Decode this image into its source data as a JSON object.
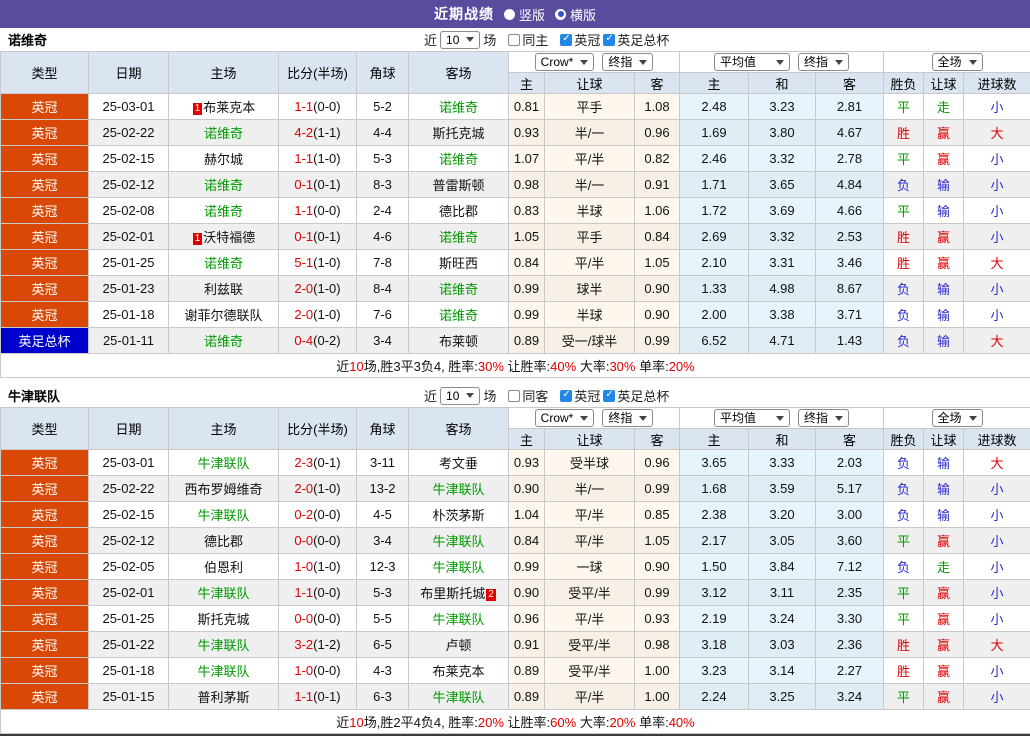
{
  "header": {
    "title": "近期战绩",
    "vertical": "竖版",
    "horizontal": "横版"
  },
  "controls": {
    "recent": "近",
    "count": "10",
    "matches": "场",
    "crow": "Crow*",
    "final": "终指",
    "avg": "平均值",
    "full": "全场"
  },
  "filters": {
    "league": "英冠",
    "cup": "英足总杯"
  },
  "columns": {
    "main": [
      "类型",
      "日期",
      "主场",
      "比分(半场)",
      "角球",
      "客场"
    ],
    "sub": [
      "主",
      "让球",
      "客",
      "主",
      "和",
      "客",
      "胜负",
      "让球",
      "进球数"
    ]
  },
  "tables": [
    {
      "team": "诺维奇",
      "same_label": "同主",
      "recent_count": "10",
      "rows": [
        {
          "type": "英冠",
          "type_style": "league",
          "date": "25-03-01",
          "home": {
            "name": "布莱克本",
            "green": false,
            "badge": "1",
            "badge_pos": "before"
          },
          "score": "1-1",
          "half": "(0-0)",
          "corner": "5-2",
          "away": {
            "name": "诺维奇",
            "green": true
          },
          "crow_home": "0.81",
          "handicap": "平手",
          "crow_away": "1.08",
          "avg_home": "2.48",
          "avg_draw": "3.23",
          "avg_away": "2.81",
          "result": "平",
          "handicap_result": "走",
          "goals": "小"
        },
        {
          "type": "英冠",
          "type_style": "league",
          "date": "25-02-22",
          "home": {
            "name": "诺维奇",
            "green": true
          },
          "score": "4-2",
          "half": "(1-1)",
          "corner": "4-4",
          "away": {
            "name": "斯托克城",
            "green": false
          },
          "crow_home": "0.93",
          "handicap": "半/一",
          "crow_away": "0.96",
          "avg_home": "1.69",
          "avg_draw": "3.80",
          "avg_away": "4.67",
          "result": "胜",
          "handicap_result": "赢",
          "goals": "大"
        },
        {
          "type": "英冠",
          "type_style": "league",
          "date": "25-02-15",
          "home": {
            "name": "赫尔城",
            "green": false
          },
          "score": "1-1",
          "half": "(1-0)",
          "corner": "5-3",
          "away": {
            "name": "诺维奇",
            "green": true
          },
          "crow_home": "1.07",
          "handicap": "平/半",
          "crow_away": "0.82",
          "avg_home": "2.46",
          "avg_draw": "3.32",
          "avg_away": "2.78",
          "result": "平",
          "handicap_result": "赢",
          "goals": "小"
        },
        {
          "type": "英冠",
          "type_style": "league",
          "date": "25-02-12",
          "home": {
            "name": "诺维奇",
            "green": true
          },
          "score": "0-1",
          "half": "(0-1)",
          "corner": "8-3",
          "away": {
            "name": "普雷斯顿",
            "green": false
          },
          "crow_home": "0.98",
          "handicap": "半/一",
          "crow_away": "0.91",
          "avg_home": "1.71",
          "avg_draw": "3.65",
          "avg_away": "4.84",
          "result": "负",
          "handicap_result": "输",
          "goals": "小"
        },
        {
          "type": "英冠",
          "type_style": "league",
          "date": "25-02-08",
          "home": {
            "name": "诺维奇",
            "green": true
          },
          "score": "1-1",
          "half": "(0-0)",
          "corner": "2-4",
          "away": {
            "name": "德比郡",
            "green": false
          },
          "crow_home": "0.83",
          "handicap": "半球",
          "crow_away": "1.06",
          "avg_home": "1.72",
          "avg_draw": "3.69",
          "avg_away": "4.66",
          "result": "平",
          "handicap_result": "输",
          "goals": "小"
        },
        {
          "type": "英冠",
          "type_style": "league",
          "date": "25-02-01",
          "home": {
            "name": "沃特福德",
            "green": false,
            "badge": "1",
            "badge_pos": "before"
          },
          "score": "0-1",
          "half": "(0-1)",
          "corner": "4-6",
          "away": {
            "name": "诺维奇",
            "green": true
          },
          "crow_home": "1.05",
          "handicap": "平手",
          "crow_away": "0.84",
          "avg_home": "2.69",
          "avg_draw": "3.32",
          "avg_away": "2.53",
          "result": "胜",
          "handicap_result": "赢",
          "goals": "小"
        },
        {
          "type": "英冠",
          "type_style": "league",
          "date": "25-01-25",
          "home": {
            "name": "诺维奇",
            "green": true
          },
          "score": "5-1",
          "half": "(1-0)",
          "corner": "7-8",
          "away": {
            "name": "斯旺西",
            "green": false
          },
          "crow_home": "0.84",
          "handicap": "平/半",
          "crow_away": "1.05",
          "avg_home": "2.10",
          "avg_draw": "3.31",
          "avg_away": "3.46",
          "result": "胜",
          "handicap_result": "赢",
          "goals": "大"
        },
        {
          "type": "英冠",
          "type_style": "league",
          "date": "25-01-23",
          "home": {
            "name": "利兹联",
            "green": false
          },
          "score": "2-0",
          "half": "(1-0)",
          "corner": "8-4",
          "away": {
            "name": "诺维奇",
            "green": true
          },
          "crow_home": "0.99",
          "handicap": "球半",
          "crow_away": "0.90",
          "avg_home": "1.33",
          "avg_draw": "4.98",
          "avg_away": "8.67",
          "result": "负",
          "handicap_result": "输",
          "goals": "小"
        },
        {
          "type": "英冠",
          "type_style": "league",
          "date": "25-01-18",
          "home": {
            "name": "谢菲尔德联队",
            "green": false
          },
          "score": "2-0",
          "half": "(1-0)",
          "corner": "7-6",
          "away": {
            "name": "诺维奇",
            "green": true
          },
          "crow_home": "0.99",
          "handicap": "半球",
          "crow_away": "0.90",
          "avg_home": "2.00",
          "avg_draw": "3.38",
          "avg_away": "3.71",
          "result": "负",
          "handicap_result": "输",
          "goals": "小"
        },
        {
          "type": "英足总杯",
          "type_style": "cup",
          "date": "25-01-11",
          "home": {
            "name": "诺维奇",
            "green": true
          },
          "score": "0-4",
          "half": "(0-2)",
          "corner": "3-4",
          "away": {
            "name": "布莱顿",
            "green": false
          },
          "crow_home": "0.89",
          "handicap": "受一/球半",
          "crow_away": "0.99",
          "avg_home": "6.52",
          "avg_draw": "4.71",
          "avg_away": "1.43",
          "result": "负",
          "handicap_result": "输",
          "goals": "大"
        }
      ],
      "summary": [
        {
          "t": "近"
        },
        {
          "t": "10",
          "red": true
        },
        {
          "t": "场,胜3平3负4, 胜率:"
        },
        {
          "t": "30%",
          "red": true
        },
        {
          "t": " 让胜率:"
        },
        {
          "t": "40%",
          "red": true
        },
        {
          "t": " 大率:"
        },
        {
          "t": "30%",
          "red": true
        },
        {
          "t": " 单率:"
        },
        {
          "t": "20%",
          "red": true
        }
      ]
    },
    {
      "team": "牛津联队",
      "same_label": "同客",
      "recent_count": "10",
      "rows": [
        {
          "type": "英冠",
          "type_style": "league",
          "date": "25-03-01",
          "home": {
            "name": "牛津联队",
            "green": true
          },
          "score": "2-3",
          "half": "(0-1)",
          "corner": "3-11",
          "away": {
            "name": "考文垂",
            "green": false
          },
          "crow_home": "0.93",
          "handicap": "受半球",
          "crow_away": "0.96",
          "avg_home": "3.65",
          "avg_draw": "3.33",
          "avg_away": "2.03",
          "result": "负",
          "handicap_result": "输",
          "goals": "大"
        },
        {
          "type": "英冠",
          "type_style": "league",
          "date": "25-02-22",
          "home": {
            "name": "西布罗姆维奇",
            "green": false
          },
          "score": "2-0",
          "half": "(1-0)",
          "corner": "13-2",
          "away": {
            "name": "牛津联队",
            "green": true
          },
          "crow_home": "0.90",
          "handicap": "半/一",
          "crow_away": "0.99",
          "avg_home": "1.68",
          "avg_draw": "3.59",
          "avg_away": "5.17",
          "result": "负",
          "handicap_result": "输",
          "goals": "小"
        },
        {
          "type": "英冠",
          "type_style": "league",
          "date": "25-02-15",
          "home": {
            "name": "牛津联队",
            "green": true
          },
          "score": "0-2",
          "half": "(0-0)",
          "corner": "4-5",
          "away": {
            "name": "朴茨茅斯",
            "green": false
          },
          "crow_home": "1.04",
          "handicap": "平/半",
          "crow_away": "0.85",
          "avg_home": "2.38",
          "avg_draw": "3.20",
          "avg_away": "3.00",
          "result": "负",
          "handicap_result": "输",
          "goals": "小"
        },
        {
          "type": "英冠",
          "type_style": "league",
          "date": "25-02-12",
          "home": {
            "name": "德比郡",
            "green": false
          },
          "score": "0-0",
          "half": "(0-0)",
          "corner": "3-4",
          "away": {
            "name": "牛津联队",
            "green": true
          },
          "crow_home": "0.84",
          "handicap": "平/半",
          "crow_away": "1.05",
          "avg_home": "2.17",
          "avg_draw": "3.05",
          "avg_away": "3.60",
          "result": "平",
          "handicap_result": "赢",
          "goals": "小"
        },
        {
          "type": "英冠",
          "type_style": "league",
          "date": "25-02-05",
          "home": {
            "name": "伯恩利",
            "green": false
          },
          "score": "1-0",
          "half": "(1-0)",
          "corner": "12-3",
          "away": {
            "name": "牛津联队",
            "green": true
          },
          "crow_home": "0.99",
          "handicap": "一球",
          "crow_away": "0.90",
          "avg_home": "1.50",
          "avg_draw": "3.84",
          "avg_away": "7.12",
          "result": "负",
          "handicap_result": "走",
          "goals": "小"
        },
        {
          "type": "英冠",
          "type_style": "league",
          "date": "25-02-01",
          "home": {
            "name": "牛津联队",
            "green": true
          },
          "score": "1-1",
          "half": "(0-0)",
          "corner": "5-3",
          "away": {
            "name": "布里斯托城",
            "green": false,
            "badge": "2",
            "badge_pos": "after"
          },
          "crow_home": "0.90",
          "handicap": "受平/半",
          "crow_away": "0.99",
          "avg_home": "3.12",
          "avg_draw": "3.11",
          "avg_away": "2.35",
          "result": "平",
          "handicap_result": "赢",
          "goals": "小"
        },
        {
          "type": "英冠",
          "type_style": "league",
          "date": "25-01-25",
          "home": {
            "name": "斯托克城",
            "green": false
          },
          "score": "0-0",
          "half": "(0-0)",
          "corner": "5-5",
          "away": {
            "name": "牛津联队",
            "green": true
          },
          "crow_home": "0.96",
          "handicap": "平/半",
          "crow_away": "0.93",
          "avg_home": "2.19",
          "avg_draw": "3.24",
          "avg_away": "3.30",
          "result": "平",
          "handicap_result": "赢",
          "goals": "小"
        },
        {
          "type": "英冠",
          "type_style": "league",
          "date": "25-01-22",
          "home": {
            "name": "牛津联队",
            "green": true
          },
          "score": "3-2",
          "half": "(1-2)",
          "corner": "6-5",
          "away": {
            "name": "卢顿",
            "green": false
          },
          "crow_home": "0.91",
          "handicap": "受平/半",
          "crow_away": "0.98",
          "avg_home": "3.18",
          "avg_draw": "3.03",
          "avg_away": "2.36",
          "result": "胜",
          "handicap_result": "赢",
          "goals": "大"
        },
        {
          "type": "英冠",
          "type_style": "league",
          "date": "25-01-18",
          "home": {
            "name": "牛津联队",
            "green": true
          },
          "score": "1-0",
          "half": "(0-0)",
          "corner": "4-3",
          "away": {
            "name": "布莱克本",
            "green": false
          },
          "crow_home": "0.89",
          "handicap": "受平/半",
          "crow_away": "1.00",
          "avg_home": "3.23",
          "avg_draw": "3.14",
          "avg_away": "2.27",
          "result": "胜",
          "handicap_result": "赢",
          "goals": "小"
        },
        {
          "type": "英冠",
          "type_style": "league",
          "date": "25-01-15",
          "home": {
            "name": "普利茅斯",
            "green": false
          },
          "score": "1-1",
          "half": "(0-1)",
          "corner": "6-3",
          "away": {
            "name": "牛津联队",
            "green": true
          },
          "crow_home": "0.89",
          "handicap": "平/半",
          "crow_away": "1.00",
          "avg_home": "2.24",
          "avg_draw": "3.25",
          "avg_away": "3.24",
          "result": "平",
          "handicap_result": "赢",
          "goals": "小"
        }
      ],
      "summary": [
        {
          "t": "近"
        },
        {
          "t": "10",
          "red": true
        },
        {
          "t": "场,胜2平4负4, 胜率:"
        },
        {
          "t": "20%",
          "red": true
        },
        {
          "t": " 让胜率:"
        },
        {
          "t": "60%",
          "red": true
        },
        {
          "t": " 大率:"
        },
        {
          "t": "20%",
          "red": true
        },
        {
          "t": " 单率:"
        },
        {
          "t": "40%",
          "red": true
        }
      ]
    }
  ]
}
